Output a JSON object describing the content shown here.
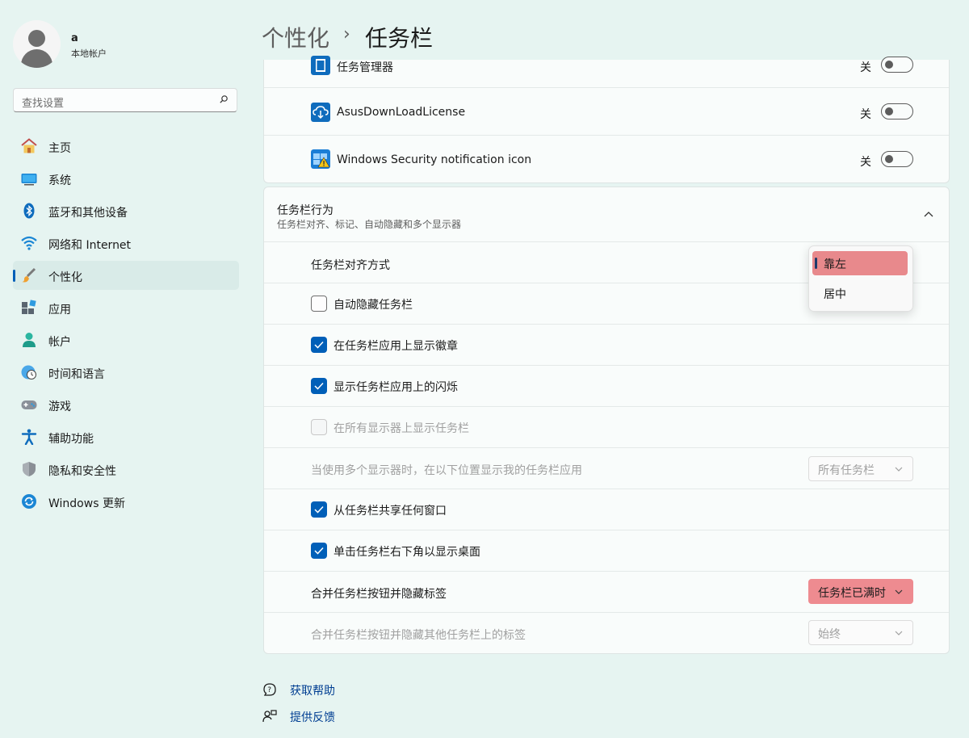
{
  "user": {
    "name": "a",
    "account_type": "本地帐户"
  },
  "search": {
    "placeholder": "查找设置"
  },
  "nav": [
    {
      "id": "home",
      "label": "主页",
      "icon": "home-icon"
    },
    {
      "id": "system",
      "label": "系统",
      "icon": "system-icon"
    },
    {
      "id": "bluetooth",
      "label": "蓝牙和其他设备",
      "icon": "bluetooth-icon"
    },
    {
      "id": "network",
      "label": "网络和 Internet",
      "icon": "wifi-icon"
    },
    {
      "id": "personalization",
      "label": "个性化",
      "icon": "brush-icon",
      "selected": true
    },
    {
      "id": "apps",
      "label": "应用",
      "icon": "apps-icon"
    },
    {
      "id": "accounts",
      "label": "帐户",
      "icon": "account-icon"
    },
    {
      "id": "time",
      "label": "时间和语言",
      "icon": "globe-clock-icon"
    },
    {
      "id": "gaming",
      "label": "游戏",
      "icon": "gamepad-icon"
    },
    {
      "id": "accessibility",
      "label": "辅助功能",
      "icon": "accessibility-icon"
    },
    {
      "id": "privacy",
      "label": "隐私和安全性",
      "icon": "shield-icon"
    },
    {
      "id": "update",
      "label": "Windows 更新",
      "icon": "update-icon"
    }
  ],
  "breadcrumb": {
    "parent": "个性化",
    "separator": "›",
    "current": "任务栏"
  },
  "tray_icons": [
    {
      "label": "任务管理器",
      "state": "关",
      "on": false
    },
    {
      "label": "AsusDownLoadLicense",
      "state": "关",
      "on": false
    },
    {
      "label": "Windows Security notification icon",
      "state": "关",
      "on": false
    }
  ],
  "behaviors": {
    "title": "任务栏行为",
    "subtitle": "任务栏对齐、标记、自动隐藏和多个显示器",
    "alignment_label": "任务栏对齐方式",
    "alignment_options": [
      "靠左",
      "居中"
    ],
    "alignment_selected": "靠左",
    "checkboxes": [
      {
        "label": "自动隐藏任务栏",
        "checked": false,
        "disabled": false
      },
      {
        "label": "在任务栏应用上显示徽章",
        "checked": true,
        "disabled": false
      },
      {
        "label": "显示任务栏应用上的闪烁",
        "checked": true,
        "disabled": false
      },
      {
        "label": "在所有显示器上显示任务栏",
        "checked": false,
        "disabled": true
      }
    ],
    "multi_monitor": {
      "label": "当使用多个显示器时，在以下位置显示我的任务栏应用",
      "value": "所有任务栏",
      "disabled": true
    },
    "checkboxes2": [
      {
        "label": "从任务栏共享任何窗口",
        "checked": true
      },
      {
        "label": "单击任务栏右下角以显示桌面",
        "checked": true
      }
    ],
    "combine": {
      "label": "合并任务栏按钮并隐藏标签",
      "value": "任务栏已满时",
      "highlight_color": "#ee8b90"
    },
    "combine_other": {
      "label": "合并任务栏按钮并隐藏其他任务栏上的标签",
      "value": "始终",
      "disabled": true
    }
  },
  "help_links": [
    {
      "label": "获取帮助",
      "icon": "help-icon"
    },
    {
      "label": "提供反馈",
      "icon": "feedback-icon"
    }
  ],
  "colors": {
    "accent": "#005fb8",
    "background": "#e6f4f1",
    "highlight": "#ee8b90"
  }
}
